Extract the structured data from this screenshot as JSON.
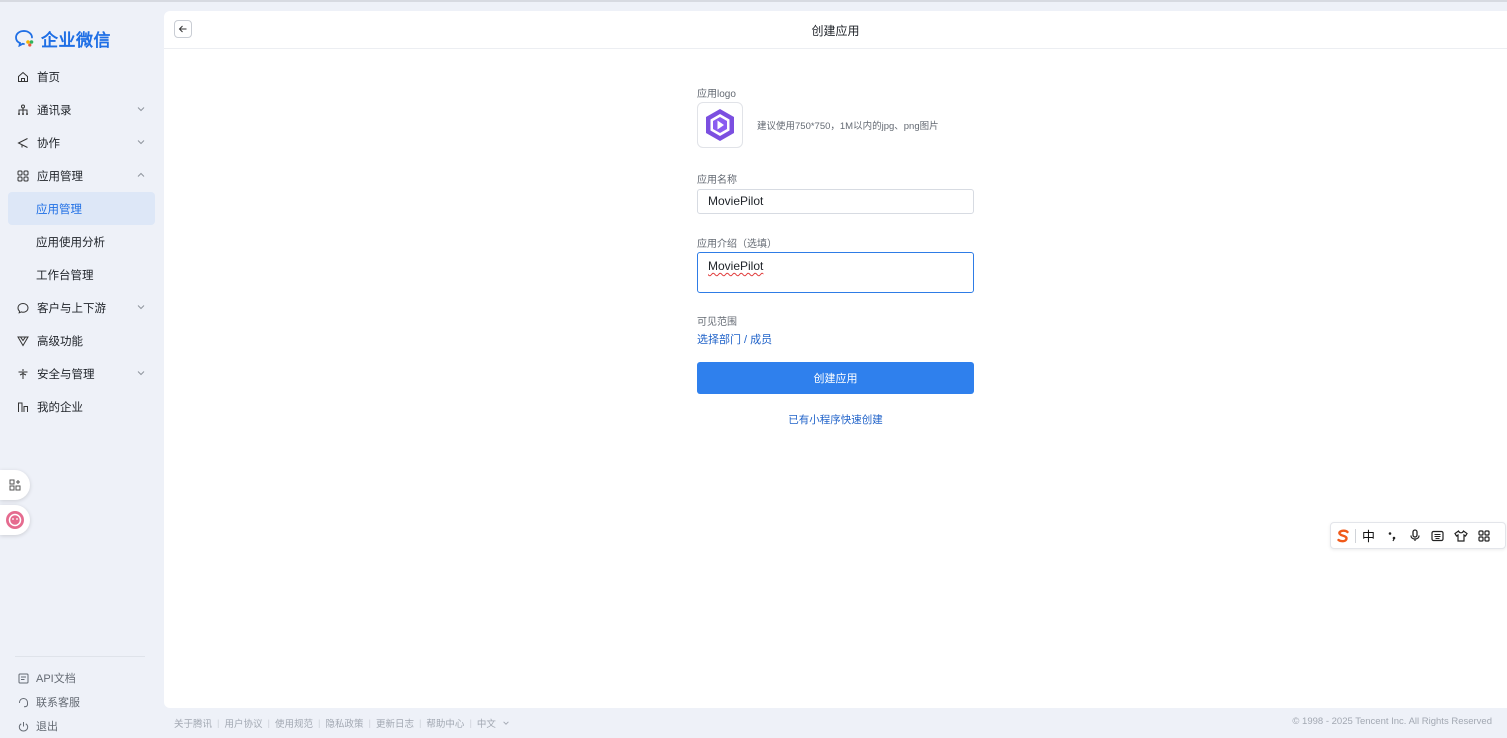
{
  "sidebar": {
    "brand": "企业微信",
    "nav": [
      {
        "label": "首页",
        "icon": "home-icon"
      },
      {
        "label": "通讯录",
        "icon": "contacts-icon"
      },
      {
        "label": "协作",
        "icon": "collab-icon"
      },
      {
        "label": "应用管理",
        "icon": "apps-icon"
      },
      {
        "label": "应用管理"
      },
      {
        "label": "应用使用分析"
      },
      {
        "label": "工作台管理"
      },
      {
        "label": "客户与上下游",
        "icon": "chat-icon"
      },
      {
        "label": "高级功能",
        "icon": "advanced-icon"
      },
      {
        "label": "安全与管理",
        "icon": "security-icon"
      },
      {
        "label": "我的企业",
        "icon": "company-icon"
      }
    ],
    "bottom": [
      {
        "label": "API文档",
        "icon": "api-doc-icon"
      },
      {
        "label": "联系客服",
        "icon": "support-icon"
      },
      {
        "label": "退出",
        "icon": "logout-icon"
      }
    ]
  },
  "header": {
    "title": "创建应用"
  },
  "form": {
    "logo_label": "应用logo",
    "logo_hint": "建议使用750*750，1M以内的jpg、png图片",
    "name_label": "应用名称",
    "name_value": "MoviePilot",
    "intro_label": "应用介绍（选填）",
    "intro_value": "MoviePilot",
    "scope_label": "可见范围",
    "scope_link": "选择部门 / 成员",
    "create_button": "创建应用",
    "miniprogram_link": "已有小程序快速创建"
  },
  "ime": {
    "lang": "中"
  },
  "footer": {
    "links": [
      "关于腾讯",
      "用户协议",
      "使用规范",
      "隐私政策",
      "更新日志",
      "帮助中心"
    ],
    "language": "中文",
    "copyright": "© 1998 - 2025 Tencent Inc. All Rights Reserved"
  },
  "colors": {
    "accent": "#2f80ed",
    "brand": "#1f6fe5",
    "logo_purple": "#7b4fe0"
  }
}
